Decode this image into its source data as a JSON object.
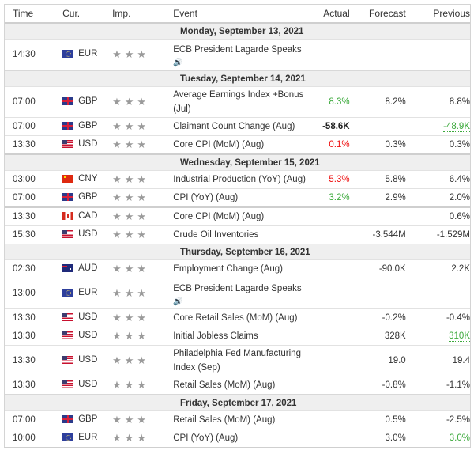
{
  "columns": {
    "time": "Time",
    "currency": "Cur.",
    "importance": "Imp.",
    "event": "Event",
    "actual": "Actual",
    "forecast": "Forecast",
    "previous": "Previous"
  },
  "importance_glyph": "★★★",
  "speaker_glyph": "🔊",
  "colors": {
    "better": "#3daa3d",
    "worse": "#ee1111",
    "day_header_bg": "#efefef",
    "star": "#9a9a9a"
  },
  "days": [
    {
      "label": "Monday, September 13, 2021",
      "events": [
        {
          "time": "14:30",
          "currency": "EUR",
          "flag": "eur-flag-icon",
          "importance": 3,
          "event": "ECB President Lagarde Speaks",
          "speech": true,
          "actual": "",
          "forecast": "",
          "previous": ""
        }
      ]
    },
    {
      "label": "Tuesday, September 14, 2021",
      "events": [
        {
          "time": "07:00",
          "currency": "GBP",
          "flag": "gbp-flag-icon",
          "importance": 3,
          "event": "Average Earnings Index +Bonus",
          "event_line2": "(Jul)",
          "actual": "8.3%",
          "actual_status": "better",
          "forecast": "8.2%",
          "previous": "8.8%"
        },
        {
          "time": "07:00",
          "currency": "GBP",
          "flag": "gbp-flag-icon",
          "importance": 3,
          "event": "Claimant Count Change (Aug)",
          "actual": "-58.6K",
          "actual_status": "neutral",
          "forecast": "",
          "previous": "-48.9K",
          "previous_status": "revised-better"
        },
        {
          "time": "13:30",
          "currency": "USD",
          "flag": "usd-flag-icon",
          "importance": 3,
          "event": "Core CPI (MoM) (Aug)",
          "actual": "0.1%",
          "actual_status": "worse",
          "forecast": "0.3%",
          "previous": "0.3%"
        }
      ]
    },
    {
      "label": "Wednesday, September 15, 2021",
      "events": [
        {
          "time": "03:00",
          "currency": "CNY",
          "flag": "cny-flag-icon",
          "importance": 3,
          "event": "Industrial Production (YoY) (Aug)",
          "actual": "5.3%",
          "actual_status": "worse",
          "forecast": "5.8%",
          "previous": "6.4%"
        },
        {
          "time": "07:00",
          "currency": "GBP",
          "flag": "gbp-flag-icon",
          "importance": 3,
          "event": "CPI (YoY) (Aug)",
          "actual": "3.2%",
          "actual_status": "better",
          "forecast": "2.9%",
          "previous": "2.0%"
        },
        {
          "time": "13:30",
          "currency": "CAD",
          "flag": "cad-flag-icon",
          "importance": 3,
          "event": "Core CPI (MoM) (Aug)",
          "actual": "",
          "forecast": "",
          "previous": "0.6%"
        },
        {
          "time": "15:30",
          "currency": "USD",
          "flag": "usd-flag-icon",
          "importance": 3,
          "event": "Crude Oil Inventories",
          "actual": "",
          "forecast": "-3.544M",
          "previous": "-1.529M"
        }
      ]
    },
    {
      "label": "Thursday, September 16, 2021",
      "events": [
        {
          "time": "02:30",
          "currency": "AUD",
          "flag": "aud-flag-icon",
          "importance": 3,
          "event": "Employment Change (Aug)",
          "actual": "",
          "forecast": "-90.0K",
          "previous": "2.2K"
        },
        {
          "time": "13:00",
          "currency": "EUR",
          "flag": "eur-flag-icon",
          "importance": 3,
          "event": "ECB President Lagarde Speaks",
          "speech": true,
          "actual": "",
          "forecast": "",
          "previous": ""
        },
        {
          "time": "13:30",
          "currency": "USD",
          "flag": "usd-flag-icon",
          "importance": 3,
          "event": "Core Retail Sales (MoM) (Aug)",
          "actual": "",
          "forecast": "-0.2%",
          "previous": "-0.4%"
        },
        {
          "time": "13:30",
          "currency": "USD",
          "flag": "usd-flag-icon",
          "importance": 3,
          "event": "Initial Jobless Claims",
          "actual": "",
          "forecast": "328K",
          "previous": "310K",
          "previous_status": "revised-better"
        },
        {
          "time": "13:30",
          "currency": "USD",
          "flag": "usd-flag-icon",
          "importance": 3,
          "event": "Philadelphia Fed Manufacturing",
          "event_line2": "Index (Sep)",
          "actual": "",
          "forecast": "19.0",
          "previous": "19.4"
        },
        {
          "time": "13:30",
          "currency": "USD",
          "flag": "usd-flag-icon",
          "importance": 3,
          "event": "Retail Sales (MoM) (Aug)",
          "actual": "",
          "forecast": "-0.8%",
          "previous": "-1.1%"
        }
      ]
    },
    {
      "label": "Friday, September 17, 2021",
      "events": [
        {
          "time": "07:00",
          "currency": "GBP",
          "flag": "gbp-flag-icon",
          "importance": 3,
          "event": "Retail Sales (MoM) (Aug)",
          "actual": "",
          "forecast": "0.5%",
          "previous": "-2.5%"
        },
        {
          "time": "10:00",
          "currency": "EUR",
          "flag": "eur-flag-icon",
          "importance": 3,
          "event": "CPI (YoY) (Aug)",
          "actual": "",
          "forecast": "3.0%",
          "previous": "3.0%",
          "previous_status": "better"
        }
      ]
    }
  ]
}
